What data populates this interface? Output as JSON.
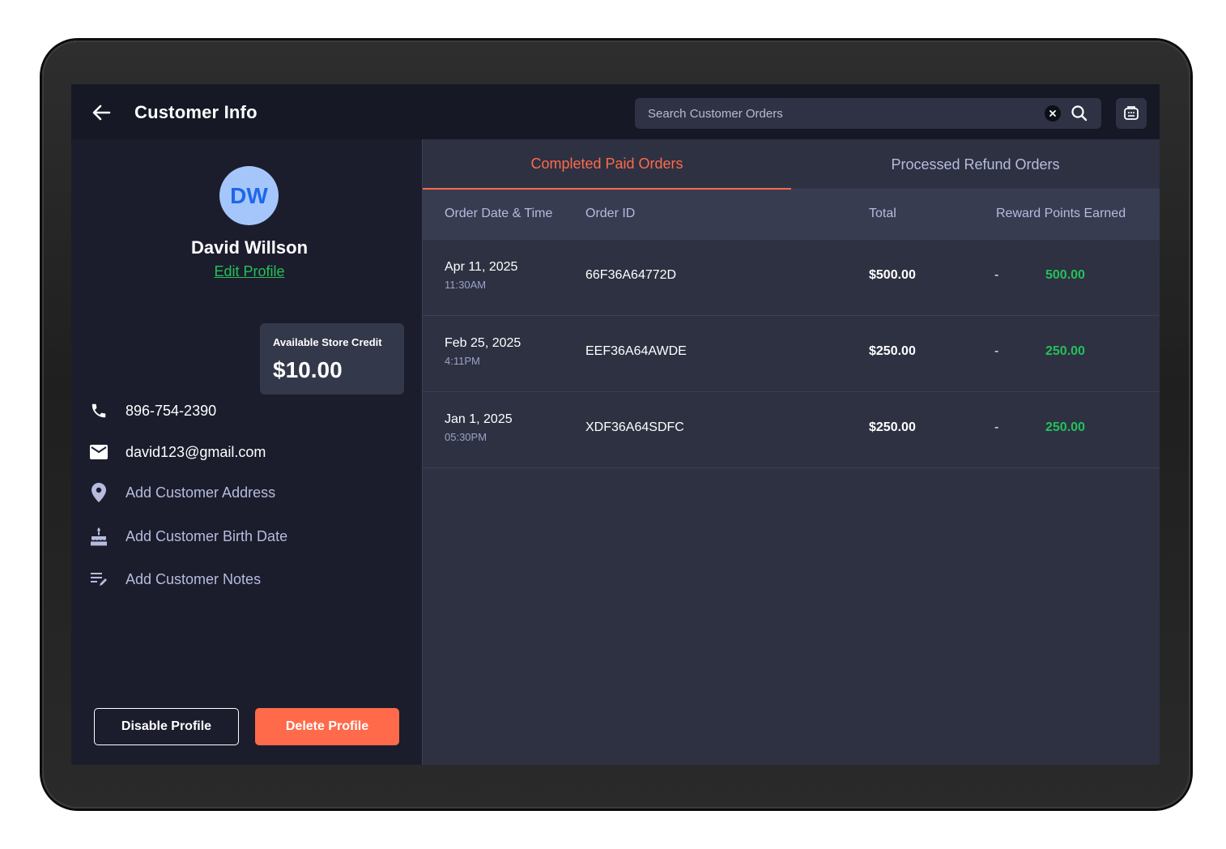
{
  "header": {
    "title": "Customer Info",
    "search_placeholder": "Search Customer Orders"
  },
  "customer": {
    "initials": "DW",
    "name": "David Willson",
    "edit_label": "Edit Profile",
    "credit_label": "Available Store Credit",
    "credit_value": "$10.00",
    "phone": "896-754-2390",
    "email": "david123@gmail.com",
    "add_address": "Add Customer Address",
    "add_birth_date": "Add Customer Birth Date",
    "add_notes": "Add Customer Notes"
  },
  "actions": {
    "disable": "Disable Profile",
    "delete": "Delete Profile"
  },
  "tabs": [
    {
      "label": "Completed Paid Orders",
      "active": true
    },
    {
      "label": "Processed Refund Orders",
      "active": false
    }
  ],
  "table": {
    "columns": [
      "Order Date & Time",
      "Order ID",
      "Total",
      "Reward Points Earned"
    ],
    "rows": [
      {
        "date": "Apr 11, 2025",
        "time": "11:30AM",
        "id": "66F36A64772D",
        "total": "$500.00",
        "dash": "-",
        "points": "500.00"
      },
      {
        "date": "Feb 25, 2025",
        "time": "4:11PM",
        "id": "EEF36A64AWDE",
        "total": "$250.00",
        "dash": "-",
        "points": "250.00"
      },
      {
        "date": "Jan 1, 2025",
        "time": "05:30PM",
        "id": "XDF36A64SDFC",
        "total": "$250.00",
        "dash": "-",
        "points": "250.00"
      }
    ]
  },
  "colors": {
    "accent": "#ff6a4b",
    "success": "#24c05a",
    "avatar_bg": "#a4c6fb",
    "avatar_text": "#1f67ea"
  }
}
